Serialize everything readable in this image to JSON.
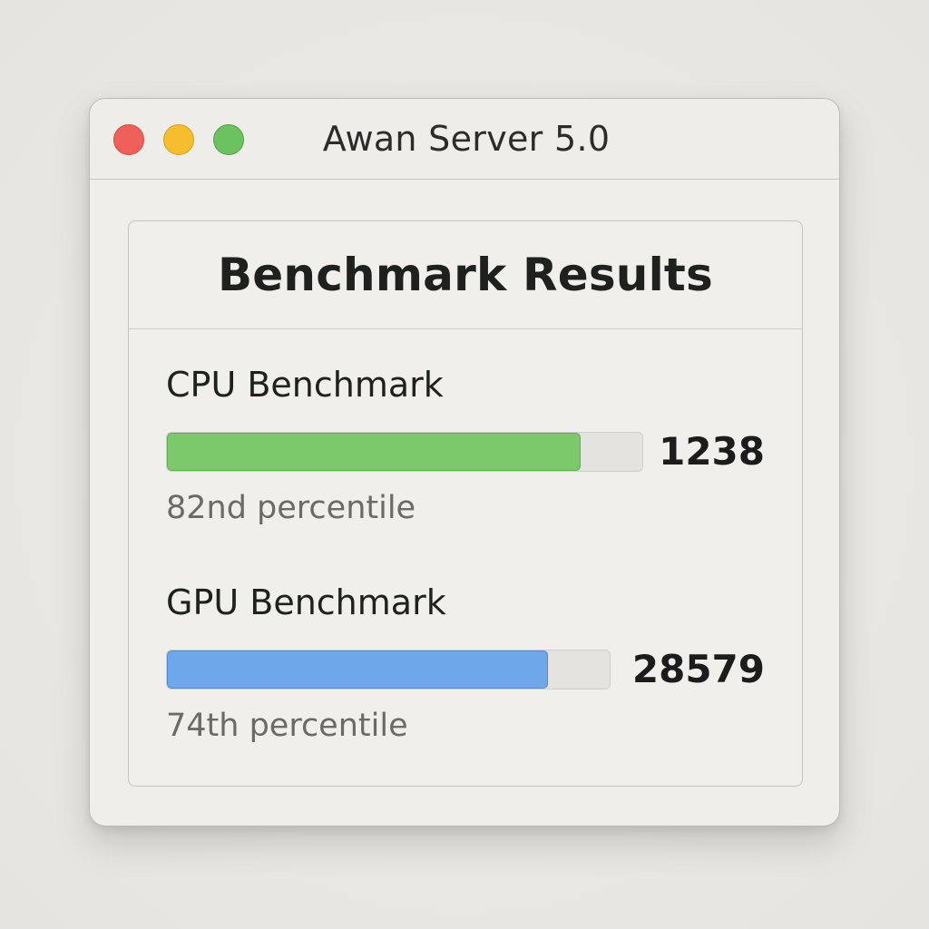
{
  "window": {
    "title": "Awan Server 5.0"
  },
  "panel": {
    "title": "Benchmark Results"
  },
  "benchmarks": [
    {
      "label": "CPU Benchmark",
      "score": "1238",
      "percentile": "82nd percentile",
      "fill_fraction": 0.87,
      "color": "#7cc96b"
    },
    {
      "label": "GPU Benchmark",
      "score": "28579",
      "percentile": "74th percentile",
      "fill_fraction": 0.86,
      "color": "#6fa8e8"
    }
  ],
  "colors": {
    "close": "#f0605a",
    "minimize": "#f6bd2f",
    "maximize": "#6cc160"
  }
}
